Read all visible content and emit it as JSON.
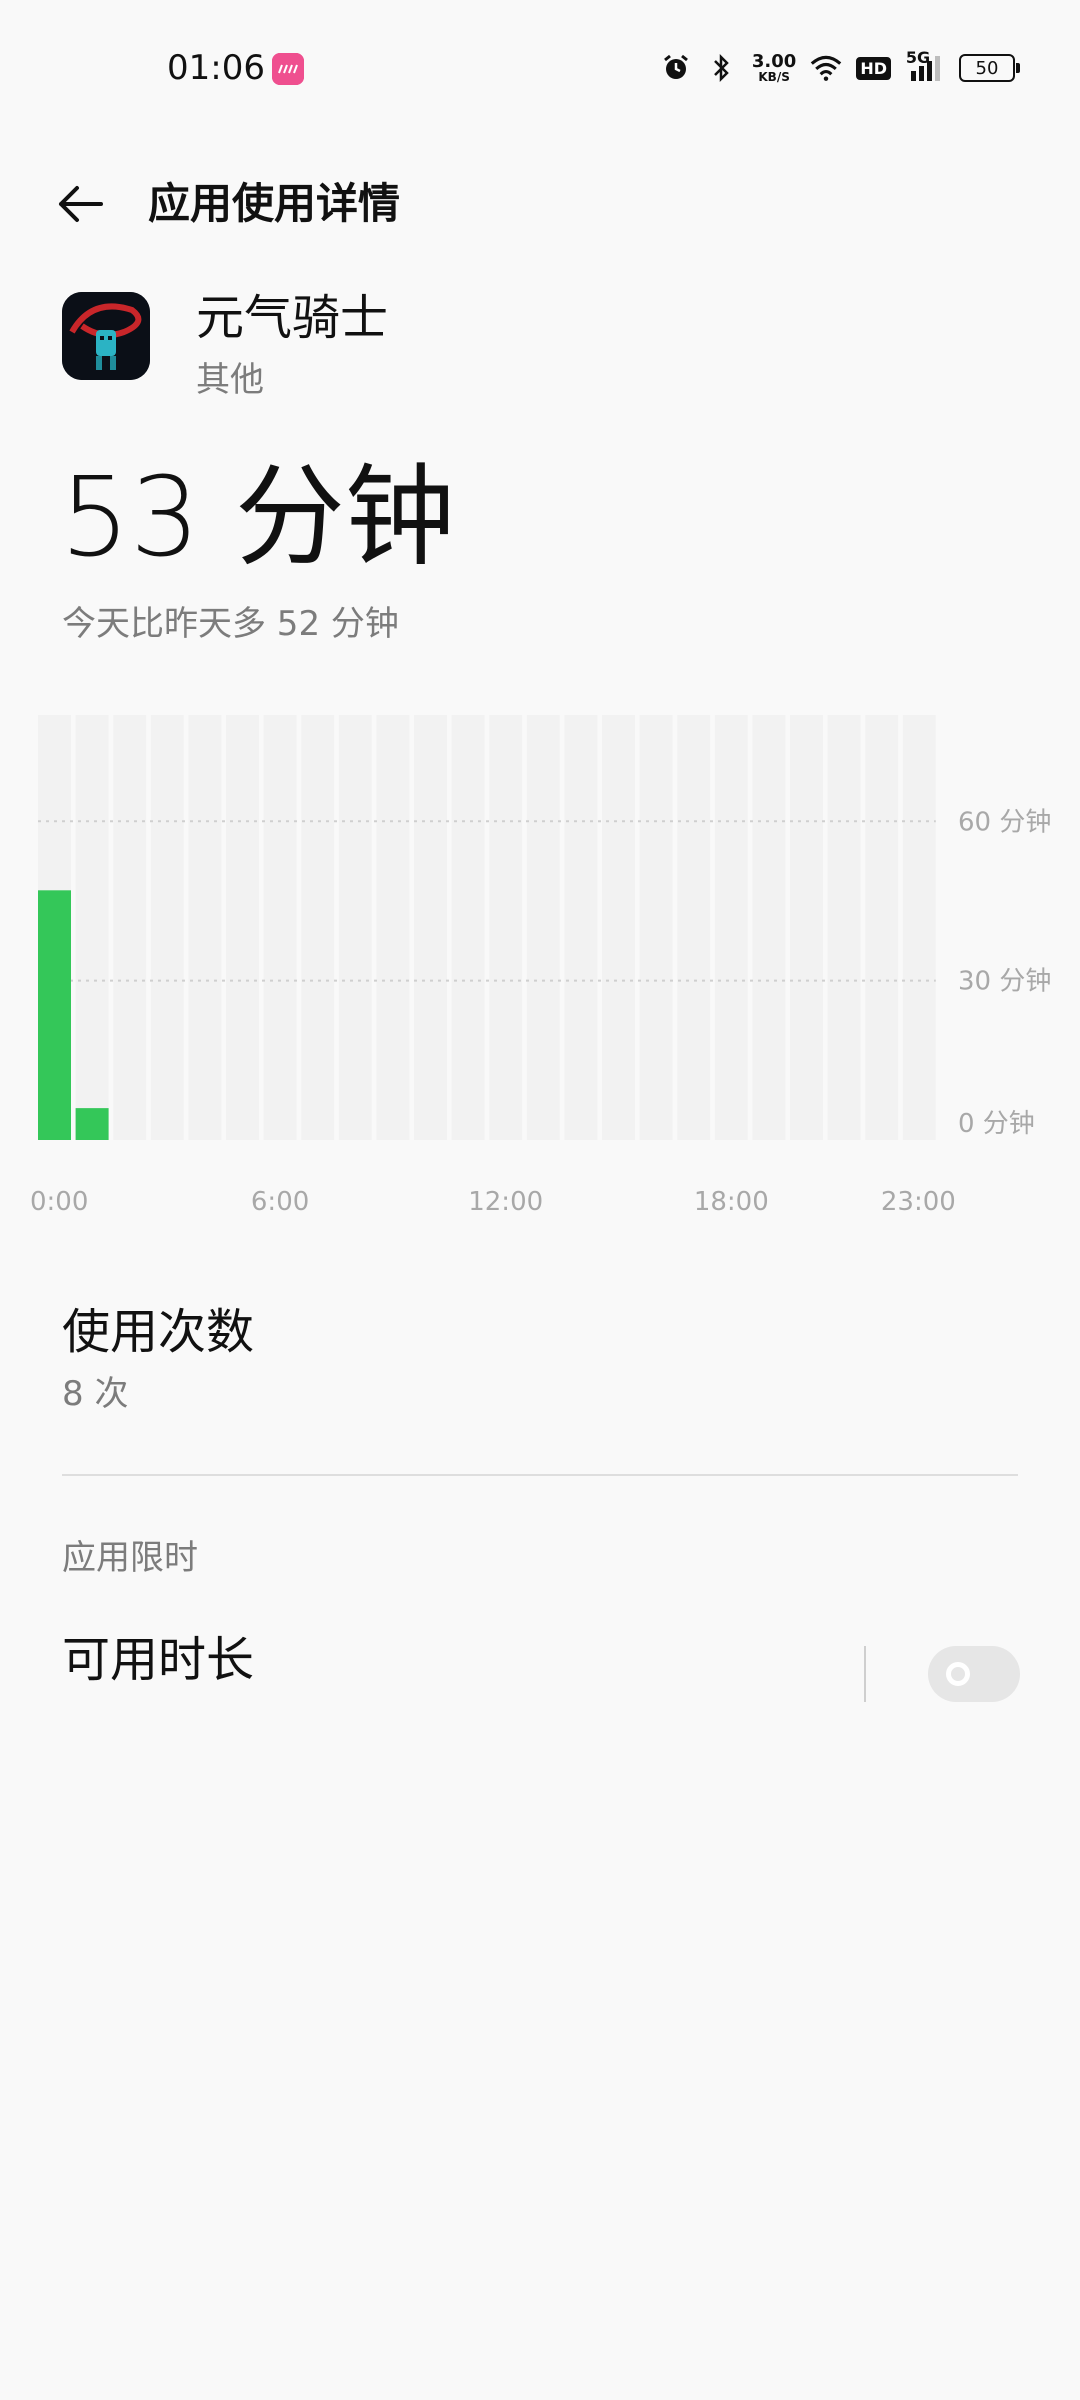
{
  "status_bar": {
    "time": "01:06",
    "notification_app": "lofter",
    "net_speed_value": "3.00",
    "net_speed_unit": "KB/S",
    "hd_label": "HD",
    "network_type": "5G",
    "battery_level": "50",
    "icons": [
      "alarm-icon",
      "bluetooth-icon",
      "wifi-icon",
      "hd-voice-icon",
      "signal-icon",
      "battery-icon"
    ]
  },
  "header": {
    "title": "应用使用详情",
    "back_icon": "arrow-left-icon"
  },
  "app": {
    "name": "元气骑士",
    "category": "其他"
  },
  "usage": {
    "total": "53 分钟",
    "comparison": "今天比昨天多 52 分钟"
  },
  "chart_data": {
    "type": "bar",
    "categories": [
      "0",
      "1",
      "2",
      "3",
      "4",
      "5",
      "6",
      "7",
      "8",
      "9",
      "10",
      "11",
      "12",
      "13",
      "14",
      "15",
      "16",
      "17",
      "18",
      "19",
      "20",
      "21",
      "22",
      "23"
    ],
    "values": [
      47,
      6,
      0,
      0,
      0,
      0,
      0,
      0,
      0,
      0,
      0,
      0,
      0,
      0,
      0,
      0,
      0,
      0,
      0,
      0,
      0,
      0,
      0,
      0
    ],
    "ylim": [
      0,
      80
    ],
    "y_ticks": [
      {
        "value": 60,
        "label": "60 分钟"
      },
      {
        "value": 30,
        "label": "30 分钟"
      },
      {
        "value": 0,
        "label": "0 分钟"
      }
    ],
    "x_ticks": [
      {
        "index": 0,
        "label": "0:00"
      },
      {
        "index": 6,
        "label": "6:00"
      },
      {
        "index": 12,
        "label": "12:00"
      },
      {
        "index": 18,
        "label": "18:00"
      },
      {
        "index": 23,
        "label": "23:00"
      }
    ],
    "bar_color": "#34c759",
    "track_color": "#f2f2f2",
    "grid": true
  },
  "count": {
    "title": "使用次数",
    "value": "8 次"
  },
  "limit": {
    "section": "应用限时",
    "title": "可用时长",
    "enabled": false
  },
  "colors": {
    "background": "#f9f9f9",
    "secondary_text": "#7c7c7c",
    "accent_green": "#34c759"
  }
}
